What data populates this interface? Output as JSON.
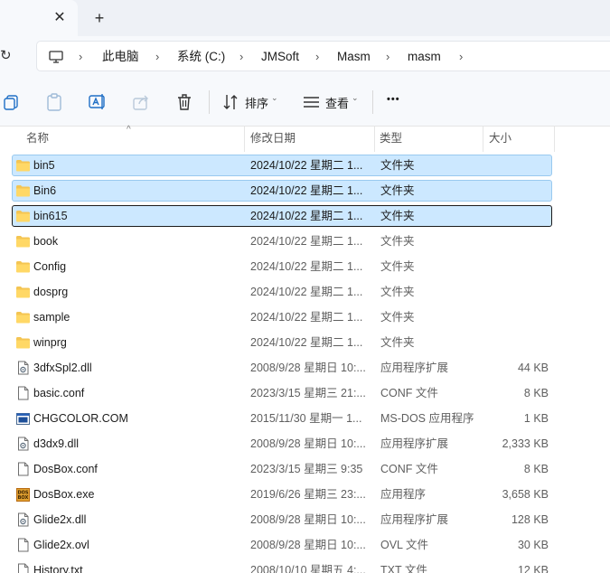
{
  "tabs": {
    "close_glyph": "✕",
    "new_tab_glyph": "+"
  },
  "address": {
    "refresh_glyph": "↻",
    "crumbs": [
      "此电脑",
      "系统 (C:)",
      "JMSoft",
      "Masm",
      "masm"
    ],
    "separator": "›"
  },
  "toolbar": {
    "sort_label": "排序",
    "view_label": "查看",
    "more_label": "•••",
    "caret": "⌄"
  },
  "columns": {
    "name": "名称",
    "date": "修改日期",
    "type": "类型",
    "size": "大小",
    "sort_indicator": "^"
  },
  "files": [
    {
      "name": "bin5",
      "date": "2024/10/22 星期二 1...",
      "type": "文件夹",
      "size": "",
      "icon": "folder-icon",
      "state": "selected"
    },
    {
      "name": "Bin6",
      "date": "2024/10/22 星期二 1...",
      "type": "文件夹",
      "size": "",
      "icon": "folder-icon",
      "state": "selected"
    },
    {
      "name": "bin615",
      "date": "2024/10/22 星期二 1...",
      "type": "文件夹",
      "size": "",
      "icon": "folder-icon",
      "state": "focused"
    },
    {
      "name": "book",
      "date": "2024/10/22 星期二 1...",
      "type": "文件夹",
      "size": "",
      "icon": "folder-icon",
      "state": ""
    },
    {
      "name": "Config",
      "date": "2024/10/22 星期二 1...",
      "type": "文件夹",
      "size": "",
      "icon": "folder-icon",
      "state": ""
    },
    {
      "name": "dosprg",
      "date": "2024/10/22 星期二 1...",
      "type": "文件夹",
      "size": "",
      "icon": "folder-icon",
      "state": ""
    },
    {
      "name": "sample",
      "date": "2024/10/22 星期二 1...",
      "type": "文件夹",
      "size": "",
      "icon": "folder-icon",
      "state": ""
    },
    {
      "name": "winprg",
      "date": "2024/10/22 星期二 1...",
      "type": "文件夹",
      "size": "",
      "icon": "folder-icon",
      "state": ""
    },
    {
      "name": "3dfxSpl2.dll",
      "date": "2008/9/28 星期日 10:...",
      "type": "应用程序扩展",
      "size": "44 KB",
      "icon": "dll-file-icon",
      "state": ""
    },
    {
      "name": "basic.conf",
      "date": "2023/3/15 星期三 21:...",
      "type": "CONF 文件",
      "size": "8 KB",
      "icon": "file-icon",
      "state": ""
    },
    {
      "name": "CHGCOLOR.COM",
      "date": "2015/11/30 星期一 1...",
      "type": "MS-DOS 应用程序",
      "size": "1 KB",
      "icon": "msdos-app-icon",
      "state": ""
    },
    {
      "name": "d3dx9.dll",
      "date": "2008/9/28 星期日 10:...",
      "type": "应用程序扩展",
      "size": "2,333 KB",
      "icon": "dll-file-icon",
      "state": ""
    },
    {
      "name": "DosBox.conf",
      "date": "2023/3/15 星期三 9:35",
      "type": "CONF 文件",
      "size": "8 KB",
      "icon": "file-icon",
      "state": ""
    },
    {
      "name": "DosBox.exe",
      "date": "2019/6/26 星期三 23:...",
      "type": "应用程序",
      "size": "3,658 KB",
      "icon": "dosbox-app-icon",
      "state": ""
    },
    {
      "name": "Glide2x.dll",
      "date": "2008/9/28 星期日 10:...",
      "type": "应用程序扩展",
      "size": "128 KB",
      "icon": "dll-file-icon",
      "state": ""
    },
    {
      "name": "Glide2x.ovl",
      "date": "2008/9/28 星期日 10:...",
      "type": "OVL 文件",
      "size": "30 KB",
      "icon": "file-icon",
      "state": ""
    },
    {
      "name": "History.txt",
      "date": "2008/10/10 星期五 4:...",
      "type": "TXT 文件",
      "size": "12 KB",
      "icon": "file-icon",
      "state": ""
    }
  ]
}
